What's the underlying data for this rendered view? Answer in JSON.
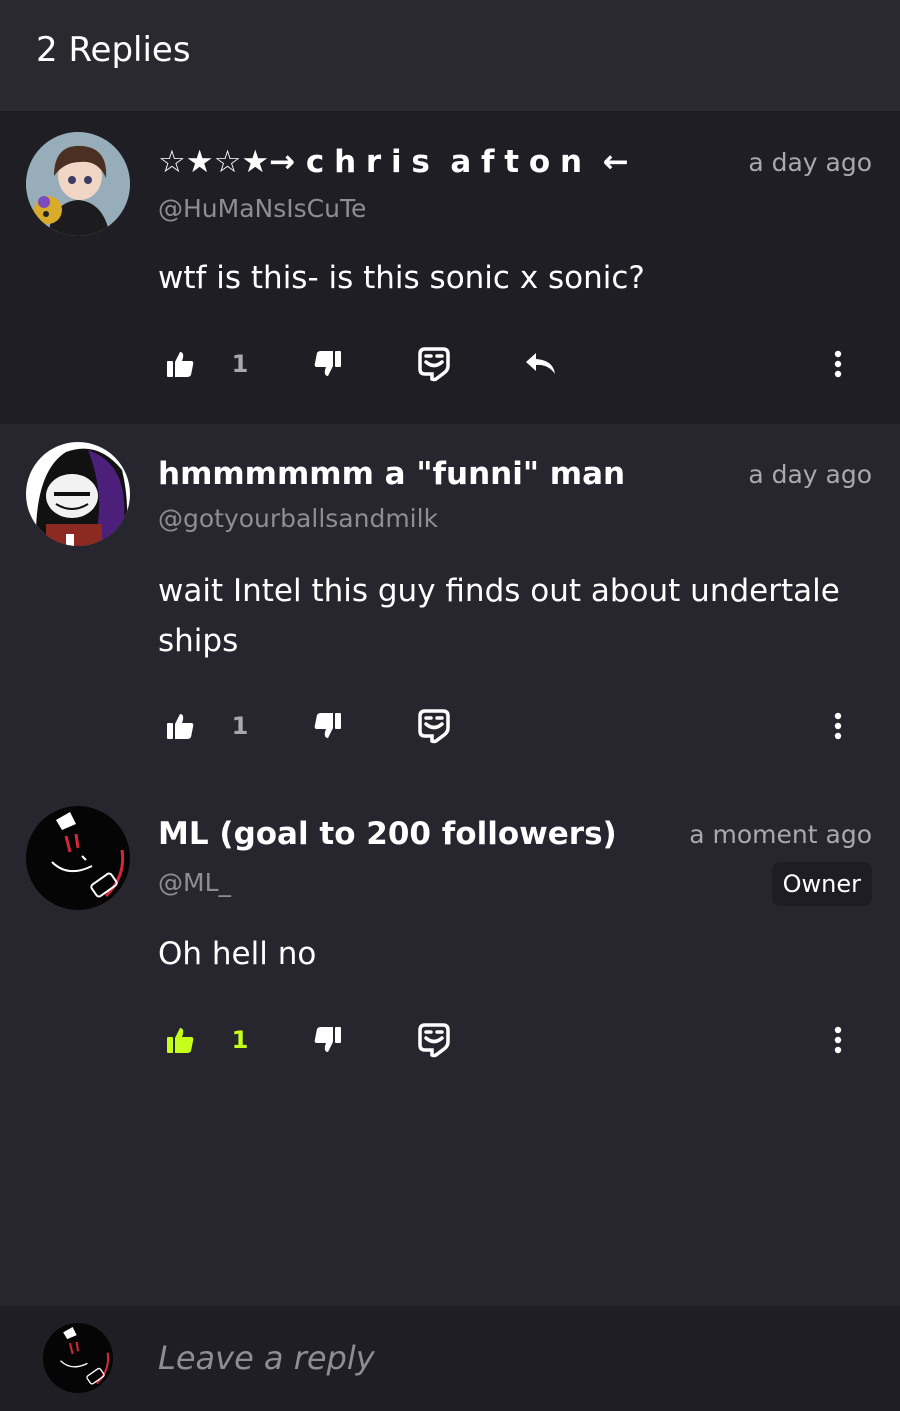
{
  "header": {
    "title": "2 Replies"
  },
  "comments": [
    {
      "author": "☆★☆★→ c𝅙h𝅙r𝅙i𝅙s𝅙 a𝅙f𝅙t𝅙o𝅙n𝅙 ←",
      "handle": "@HuMaNsIsCuTe",
      "time": "a day ago",
      "text": "wtf is this- is this sonic x sonic?",
      "likes": "1",
      "liked": false
    },
    {
      "author": "hmmmmmm a \"funni\" man",
      "handle": "@gotyourballsandmilk",
      "time": "a day ago",
      "text": "wait Intel this guy finds out about undertale ships",
      "likes": "1",
      "liked": false
    },
    {
      "author": "ML (goal to 200 followers)",
      "handle": "@ML_",
      "time": "a moment ago",
      "badge": "Owner",
      "text": "Oh hell no",
      "likes": "1",
      "liked": true
    }
  ],
  "reply_box": {
    "placeholder": "Leave a reply"
  },
  "icons": {
    "like": "thumbs-up-icon",
    "dislike": "thumbs-down-icon",
    "sticker": "sticker-icon",
    "reply": "reply-arrow-icon",
    "more": "more-vertical-icon"
  },
  "colors": {
    "background": "#27262f",
    "parent_background": "#1f1e25",
    "accent_liked": "#c6ff1a",
    "muted_text": "#8e8d95"
  }
}
